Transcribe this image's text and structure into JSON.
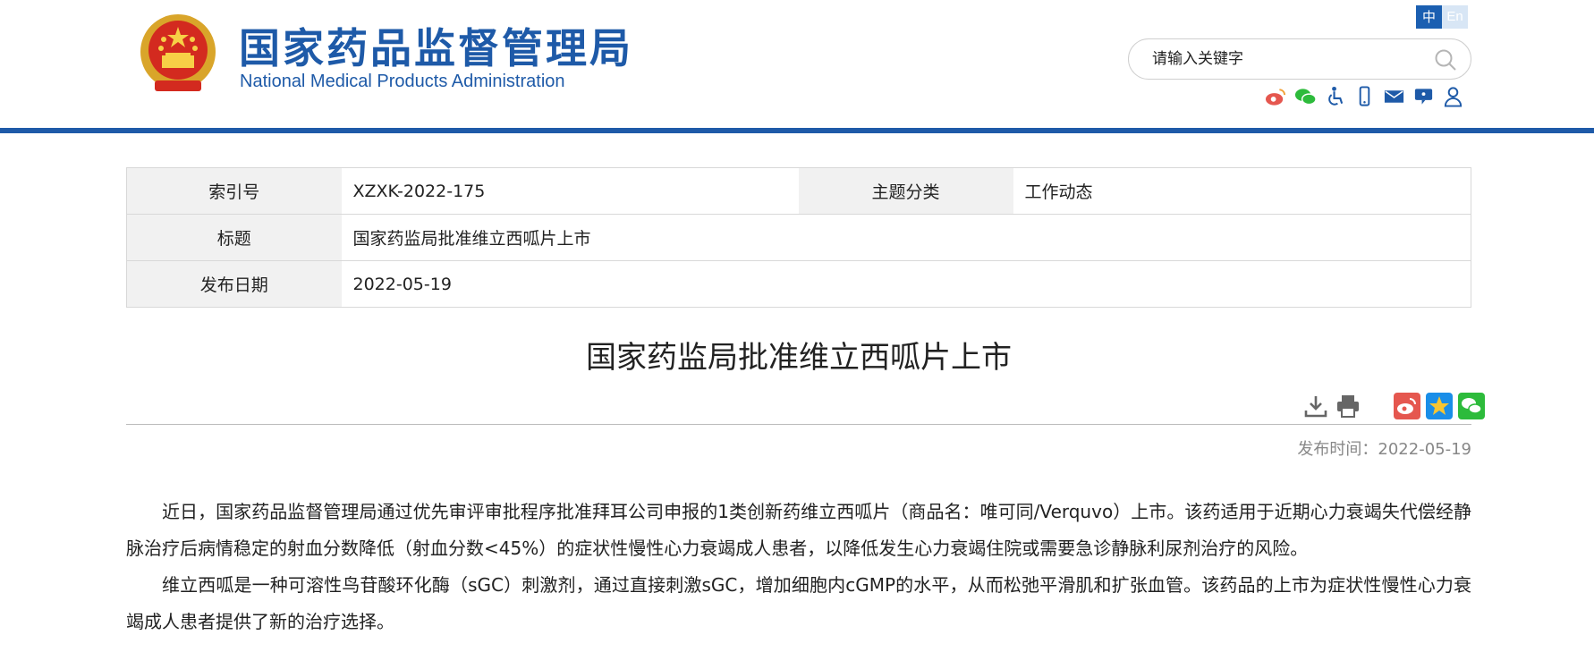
{
  "header": {
    "logo_cn": "国家药品监督管理局",
    "logo_en": "National Medical Products Administration",
    "lang_zh": "中",
    "lang_en": "En",
    "search_placeholder": "请输入关键字",
    "icons": [
      "weibo-icon",
      "wechat-icon",
      "accessibility-icon",
      "mobile-icon",
      "mail-icon",
      "feedback-icon",
      "user-icon"
    ]
  },
  "meta": {
    "index_label": "索引号",
    "index_value": "XZXK-2022-175",
    "topic_label": "主题分类",
    "topic_value": "工作动态",
    "title_label": "标题",
    "title_value": "国家药监局批准维立西呱片上市",
    "date_label": "发布日期",
    "date_value": "2022-05-19"
  },
  "article": {
    "title": "国家药监局批准维立西呱片上市",
    "pub_time": "发布时间：2022-05-19",
    "paragraphs": [
      "近日，国家药品监督管理局通过优先审评审批程序批准拜耳公司申报的1类创新药维立西呱片（商品名：唯可同/Verquvo）上市。该药适用于近期心力衰竭失代偿经静脉治疗后病情稳定的射血分数降低（射血分数<45%）的症状性慢性心力衰竭成人患者，以降低发生心力衰竭住院或需要急诊静脉利尿剂治疗的风险。",
      "维立西呱是一种可溶性鸟苷酸环化酶（sGC）刺激剂，通过直接刺激sGC，增加细胞内cGMP的水平，从而松弛平滑肌和扩张血管。该药品的上市为症状性慢性心力衰竭成人患者提供了新的治疗选择。"
    ]
  },
  "colors": {
    "brand_blue": "#1e5aa8",
    "weibo_red": "#e5574f",
    "wechat_green": "#2dbb3b",
    "qzone_blue": "#1a8ee8"
  }
}
